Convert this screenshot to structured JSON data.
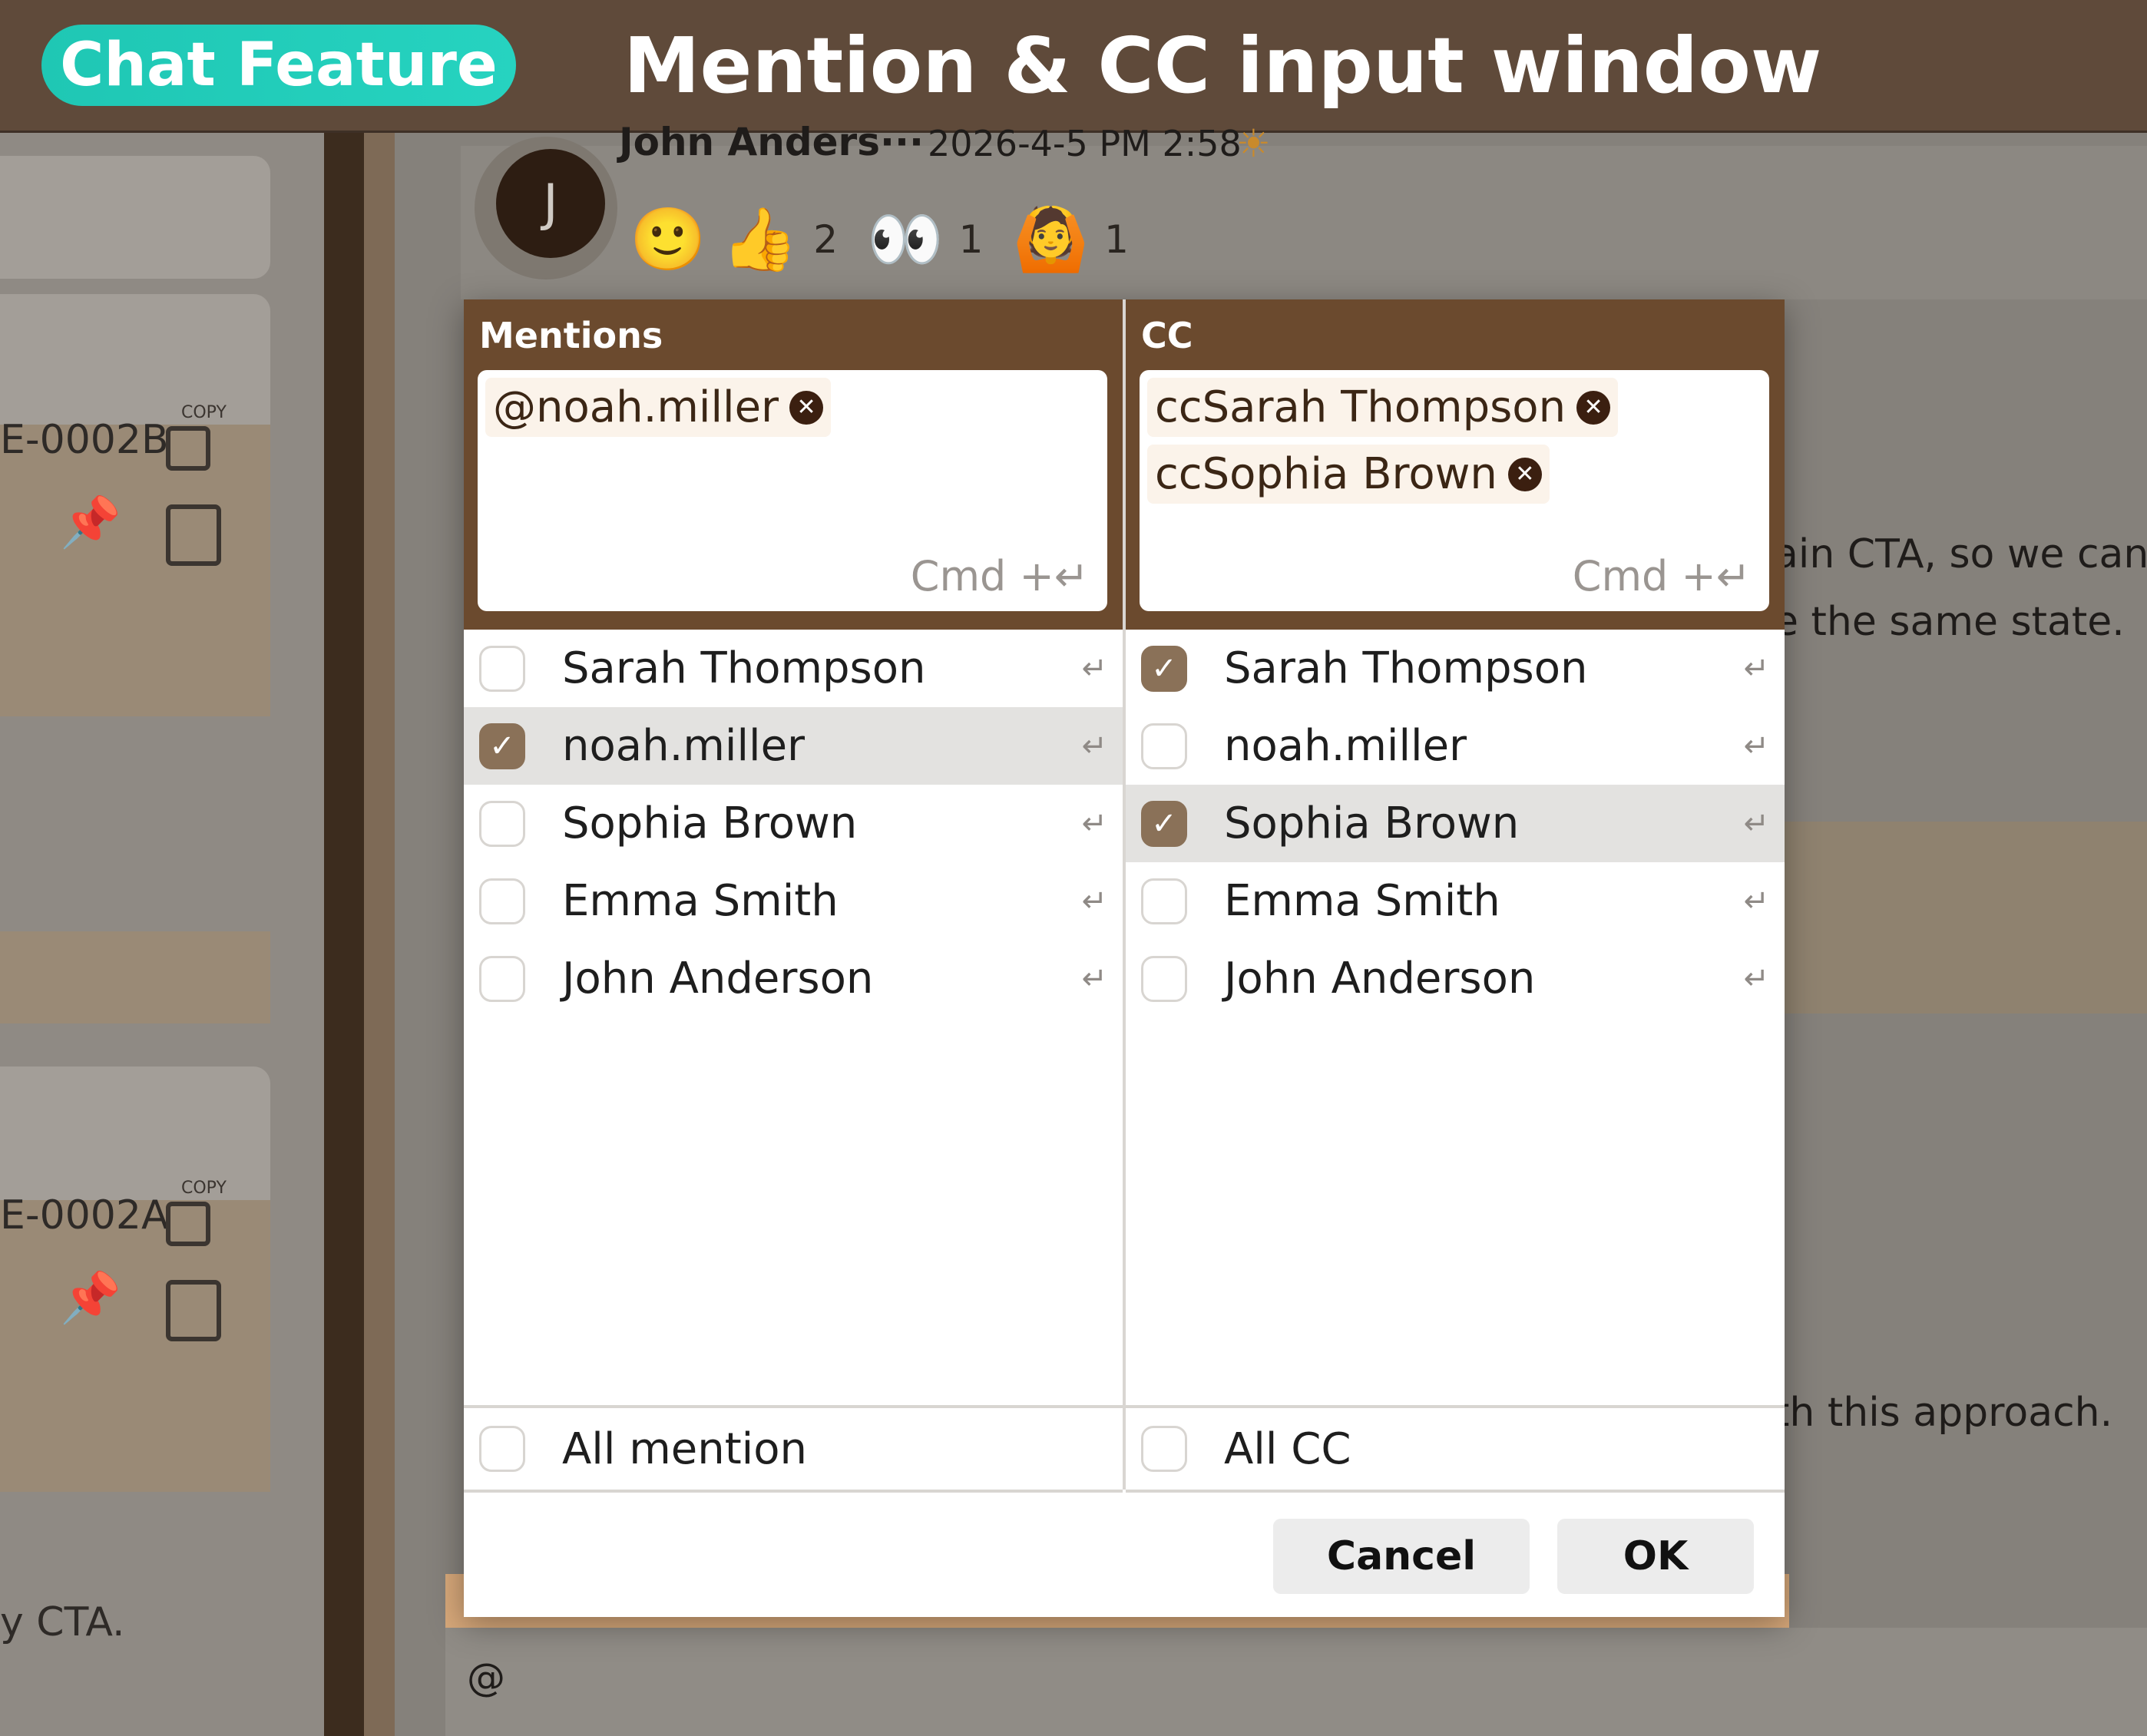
{
  "banner": {
    "badge": "Chat Feature",
    "title": "Mention & CC input window"
  },
  "background": {
    "sender": "John Anders···",
    "timestamp": "2026-4-5 PM 2:58",
    "avatar_initial": "J",
    "reactions": [
      {
        "emoji": "👍",
        "count": "2"
      },
      {
        "emoji": "👀",
        "count": "1"
      },
      {
        "emoji": "🙆",
        "count": "1"
      }
    ],
    "tickets": [
      {
        "id": "E-0002B",
        "copy_label": "COPY"
      },
      {
        "id": "E-0002A",
        "copy_label": "COPY"
      }
    ],
    "left_snippet": "y CTA.",
    "text_line1": "ain CTA, so we can",
    "text_line2": "e the same state.",
    "text_line3": "th this approach.",
    "input_value": "@"
  },
  "mentions": {
    "title": "Mentions",
    "chips": [
      "@noah.miller"
    ],
    "hint": "Cmd +↵",
    "items": [
      {
        "label": "Sarah Thompson",
        "checked": false
      },
      {
        "label": "noah.miller",
        "checked": true
      },
      {
        "label": "Sophia Brown",
        "checked": false
      },
      {
        "label": "Emma Smith",
        "checked": false
      },
      {
        "label": "John Anderson",
        "checked": false
      }
    ],
    "all_label": "All mention"
  },
  "cc": {
    "title": "CC",
    "chips": [
      "ccSarah Thompson",
      "ccSophia Brown"
    ],
    "hint": "Cmd +↵",
    "items": [
      {
        "label": "Sarah Thompson",
        "checked": true
      },
      {
        "label": "noah.miller",
        "checked": false
      },
      {
        "label": "Sophia Brown",
        "checked": true
      },
      {
        "label": "Emma Smith",
        "checked": false
      },
      {
        "label": "John Anderson",
        "checked": false
      }
    ],
    "all_label": "All CC"
  },
  "buttons": {
    "cancel": "Cancel",
    "ok": "OK"
  },
  "colors": {
    "brand": "#6b4a2e",
    "badge": "#22cbb8",
    "checked": "#8a7158"
  }
}
